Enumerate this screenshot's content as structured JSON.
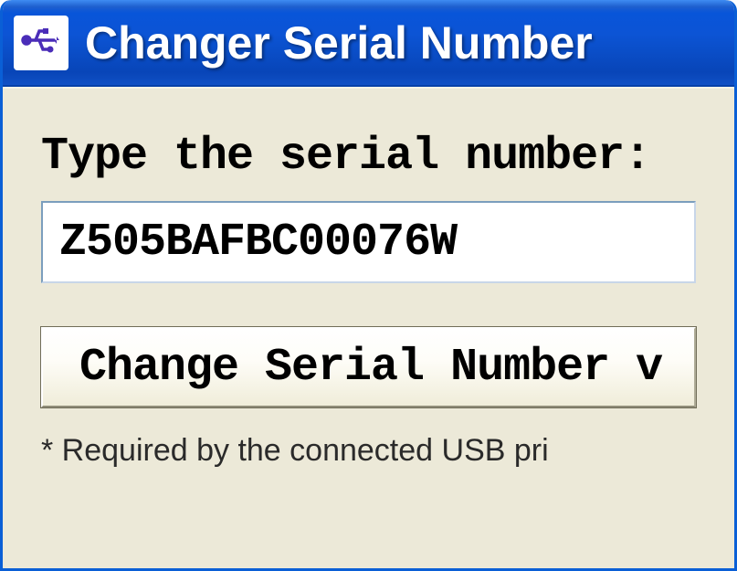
{
  "window": {
    "title": "Changer Serial Number",
    "icon": "usb-icon"
  },
  "form": {
    "label": "Type the serial number:",
    "serial_value": "Z505BAFBC00076W",
    "button_label": "Change Serial Number v",
    "footnote": "* Required by the connected USB pri"
  }
}
